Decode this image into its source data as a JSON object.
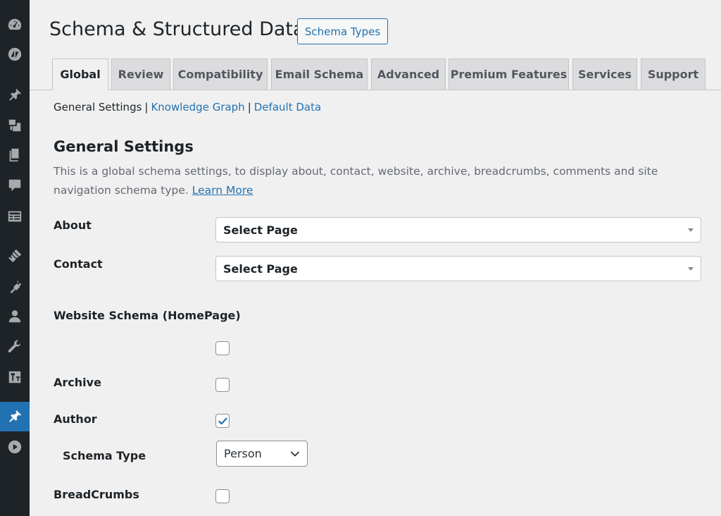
{
  "sidebar": {
    "icons": [
      "dashboard-icon",
      "jetpack-icon",
      "posts-pin-icon",
      "media-icon",
      "pages-icon",
      "comments-icon",
      "forms-icon",
      "appearance-icon",
      "plugins-icon",
      "users-icon",
      "tools-icon",
      "settings-icon",
      "schema-pin-icon",
      "play-icon"
    ],
    "active": "schema-pin-icon"
  },
  "header": {
    "title": "Schema & Structured Data",
    "button_label": "Schema Types"
  },
  "tabs": [
    {
      "label": "Global",
      "active": true
    },
    {
      "label": "Review",
      "active": false
    },
    {
      "label": "Compatibility",
      "active": false
    },
    {
      "label": "Email Schema",
      "active": false
    },
    {
      "label": "Advanced",
      "active": false
    },
    {
      "label": "Premium Features",
      "active": false
    },
    {
      "label": "Services",
      "active": false
    },
    {
      "label": "Support",
      "active": false
    }
  ],
  "subnav": {
    "current": "General Settings",
    "separator": "|",
    "links": [
      "Knowledge Graph",
      "Default Data"
    ]
  },
  "section": {
    "title": "General Settings",
    "description": "This is a global schema settings, to display about, contact, website, archive, breadcrumbs, comments and site navigation schema type.",
    "learn_more": "Learn More"
  },
  "form": {
    "about": {
      "label": "About",
      "value": "Select Page"
    },
    "contact": {
      "label": "Contact",
      "value": "Select Page"
    },
    "website": {
      "label": "Website Schema (HomePage)",
      "checked": false
    },
    "archive": {
      "label": "Archive",
      "checked": false
    },
    "author": {
      "label": "Author",
      "checked": true
    },
    "schema_type": {
      "label": "Schema Type",
      "value": "Person"
    },
    "breadcrumbs": {
      "label": "BreadCrumbs",
      "checked": false
    }
  },
  "colors": {
    "accent": "#2271b1",
    "sidebar_bg": "#1d2327",
    "page_bg": "#f0f0f1"
  }
}
